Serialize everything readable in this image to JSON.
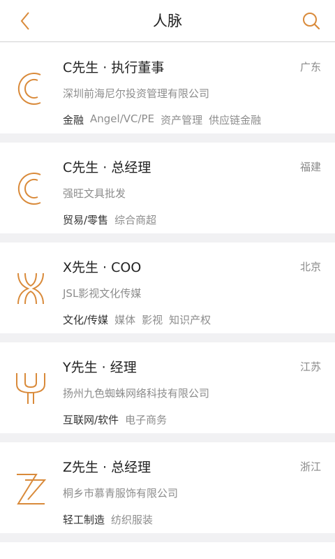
{
  "header": {
    "title": "人脉",
    "back_icon": "chevron-left-icon",
    "search_icon": "search-icon",
    "accent_color": "#d98a3a"
  },
  "contacts": [
    {
      "name": "C先生 · 执行董事",
      "region": "广东",
      "company": "深圳前海尼尔投资管理有限公司",
      "logo": "letter-c-logo",
      "primary_tag": "金融",
      "secondary_tags": [
        "Angel/VC/PE",
        "资产管理",
        "供应链金融"
      ]
    },
    {
      "name": "C先生 · 总经理",
      "region": "福建",
      "company": "强旺文具批发",
      "logo": "letter-c-logo",
      "primary_tag": "贸易/零售",
      "secondary_tags": [
        "综合商超"
      ]
    },
    {
      "name": "X先生 · COO",
      "region": "北京",
      "company": "JSL影视文化传媒",
      "logo": "letter-x-logo",
      "primary_tag": "文化/传媒",
      "secondary_tags": [
        "媒体",
        "影视",
        "知识产权"
      ]
    },
    {
      "name": "Y先生 · 经理",
      "region": "江苏",
      "company": "扬州九色蜘蛛网络科技有限公司",
      "logo": "letter-y-logo",
      "primary_tag": "互联网/软件",
      "secondary_tags": [
        "电子商务"
      ]
    },
    {
      "name": "Z先生 · 总经理",
      "region": "浙江",
      "company": "桐乡市慕青服饰有限公司",
      "logo": "letter-z-logo",
      "primary_tag": "轻工制造",
      "secondary_tags": [
        "纺织服装"
      ]
    }
  ]
}
